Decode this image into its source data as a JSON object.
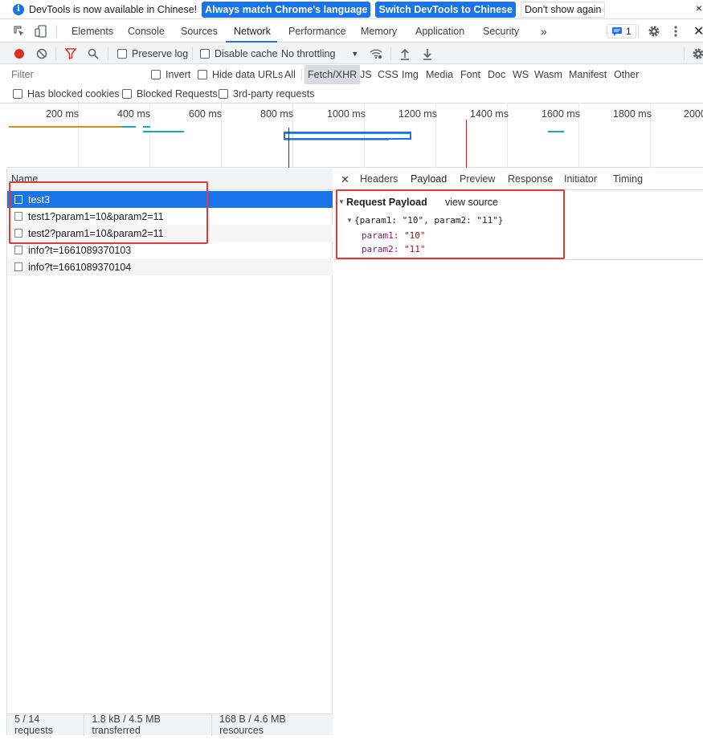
{
  "infobar": {
    "message": "DevTools is now available in Chinese!",
    "btn_match": "Always match Chrome's language",
    "btn_switch": "Switch DevTools to Chinese",
    "btn_dismiss": "Don't show again",
    "close": "×"
  },
  "tabs": [
    "Elements",
    "Console",
    "Sources",
    "Network",
    "Performance",
    "Memory",
    "Application",
    "Security"
  ],
  "active_tab": "Network",
  "overflow": "»",
  "issues_count": "1",
  "toolbar": {
    "preserve_log": "Preserve log",
    "disable_cache": "Disable cache",
    "throttling": "No throttling"
  },
  "filter": {
    "placeholder": "Filter",
    "invert": "Invert",
    "hide_data_urls": "Hide data URLs",
    "types": [
      "All",
      "Fetch/XHR",
      "JS",
      "CSS",
      "Img",
      "Media",
      "Font",
      "Doc",
      "WS",
      "Wasm",
      "Manifest",
      "Other"
    ],
    "selected_type": "Fetch/XHR",
    "has_blocked_cookies": "Has blocked cookies",
    "blocked_requests": "Blocked Requests",
    "third_party": "3rd-party requests"
  },
  "timeline": {
    "ticks": [
      "200 ms",
      "400 ms",
      "600 ms",
      "800 ms",
      "1000 ms",
      "1200 ms",
      "1400 ms",
      "1600 ms",
      "1800 ms",
      "2000"
    ]
  },
  "requests": {
    "header": "Name",
    "rows": [
      {
        "name": "test3"
      },
      {
        "name": "test1?param1=10&param2=11"
      },
      {
        "name": "test2?param1=10&param2=11"
      },
      {
        "name": "info?t=1661089370103"
      },
      {
        "name": "info?t=1661089370104"
      }
    ],
    "selected_index": 0
  },
  "status": {
    "requests": "5 / 14 requests",
    "transferred": "1.8 kB / 4.5 MB transferred",
    "resources": "168 B / 4.6 MB resources"
  },
  "detail_tabs": [
    "Headers",
    "Payload",
    "Preview",
    "Response",
    "Initiator",
    "Timing"
  ],
  "payload": {
    "section_title": "Request Payload",
    "view_source": "view source",
    "summary": "{param1: \"10\", param2: \"11\"}",
    "entries": [
      {
        "key": "param1:",
        "value": "\"10\""
      },
      {
        "key": "param2:",
        "value": "\"11\""
      }
    ]
  }
}
